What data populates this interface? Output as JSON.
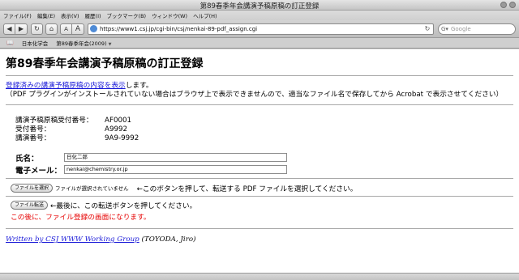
{
  "window": {
    "title": "第89春季年会講演予稿原稿の訂正登録"
  },
  "menu": [
    "ファイル(F)",
    "編集(E)",
    "表示(V)",
    "履歴(I)",
    "ブックマーク(B)",
    "ウィンドウ(W)",
    "ヘルプ(H)"
  ],
  "toolbar": {
    "back": "◀",
    "forward": "▶",
    "reload": "↻",
    "home": "⌂",
    "font_small": "A",
    "font_large": "A",
    "url": "https://www1.csj.jp/cgi-bin/csj/nenkai-89-pdf_assign.cgi",
    "search_placeholder": "Google",
    "search_g": "G▾"
  },
  "bookmarks": [
    "日本化学会",
    "第89春季年会(2009)"
  ],
  "page": {
    "heading": "第89春季年会講演予稿原稿の訂正登録",
    "intro_link": "登録済みの講演予稿原稿の内容を表示",
    "intro_suffix": "します。",
    "intro_note": "（PDF プラグインがインストールされていない場合はブラウザ上で表示できませんので、適当なファイル名で保存してから Acrobat で表示させてください）",
    "info": [
      {
        "label": "講演予稿原稿受付番号：",
        "value": "AF0001"
      },
      {
        "label": "受付番号：",
        "value": "A9992"
      },
      {
        "label": "講演番号：",
        "value": "9A9-9992"
      }
    ],
    "name_label": "氏名：",
    "name_value": "日化二郎",
    "email_label": "電子メール：",
    "email_value": "nenkai@chemistry.or.jp",
    "file_button": "ファイルを選択",
    "file_status": "ファイルが選択されていません",
    "file_hint": "←このボタンを押して、転送する PDF ファイルを選択してください。",
    "send_button": "ファイル転送",
    "send_hint": "←最後に、この転送ボタンを押してください。",
    "warning": "この後に、ファイル登録の画面になります。",
    "footer_link": "Written by CSJ WWW Working Group",
    "footer_suffix": " (TOYODA, Jiro)"
  }
}
